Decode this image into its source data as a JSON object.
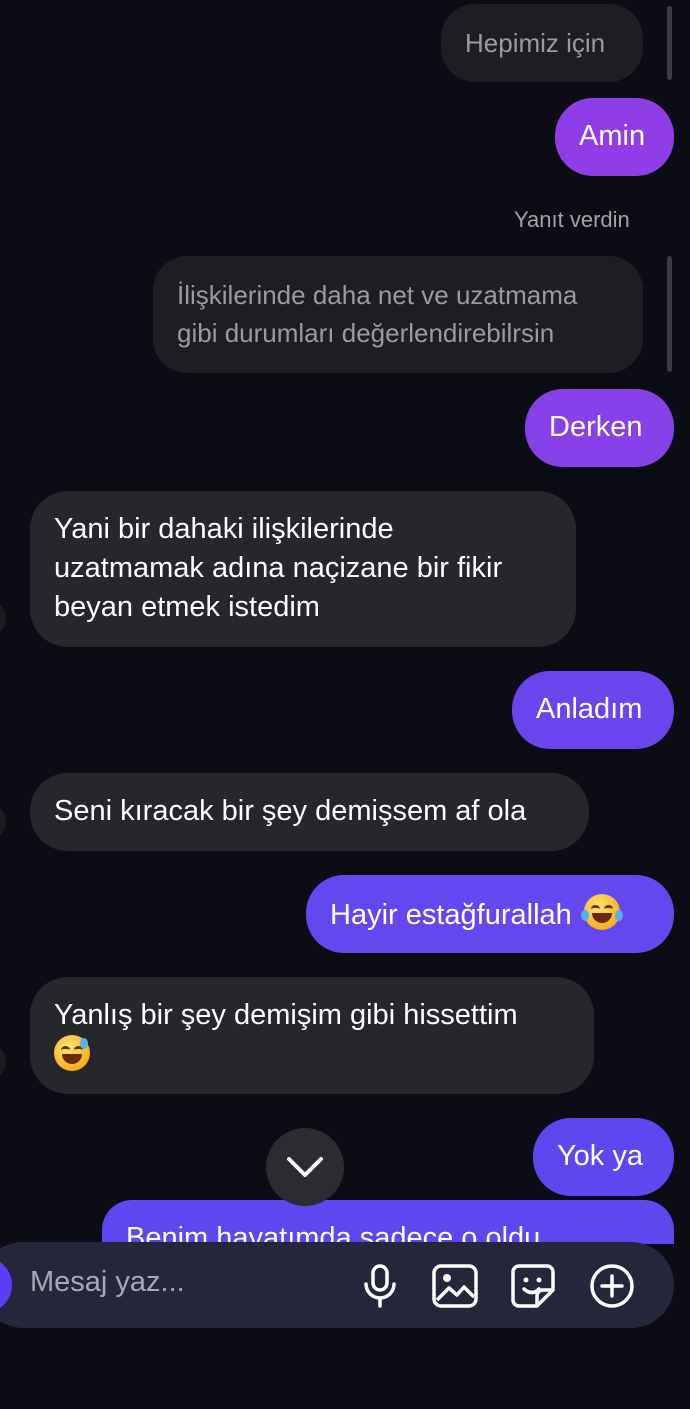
{
  "messages": {
    "m1": "Hepimiz için",
    "m2": "Amin",
    "reply_meta": "Yanıt verdin",
    "quoted_line1": "İlişkilerinde daha net ve uzatmama",
    "quoted_line2": "gibi durumları değerlendirebilrsin",
    "m3": "Derken",
    "m4_line1": "Yani bir dahaki ilişkilerinde",
    "m4_line2": "uzatmamak adına naçizane bir fikir",
    "m4_line3": "beyan etmek istedim",
    "m5": "Anladım",
    "m6": "Seni kıracak bir şey demişsem af ola",
    "m7": "Hayir estağfurallah",
    "m8": "Yanlış bir şey demişim gibi hissettim",
    "m9": "Yok ya",
    "m10": "Benim hayatımda sadece o oldu"
  },
  "composer": {
    "placeholder": "Mesaj yaz..."
  },
  "icons": {
    "scroll_down": "chevron-down-icon",
    "mic": "microphone-icon",
    "gallery": "image-icon",
    "sticker": "sticker-icon",
    "plus": "plus-circle-icon"
  },
  "colors": {
    "background": "#0b0c14",
    "incoming_bubble": "#26272d",
    "outgoing_gradient_top": "#8f3ee6",
    "outgoing_gradient_bottom": "#5e46f0"
  }
}
